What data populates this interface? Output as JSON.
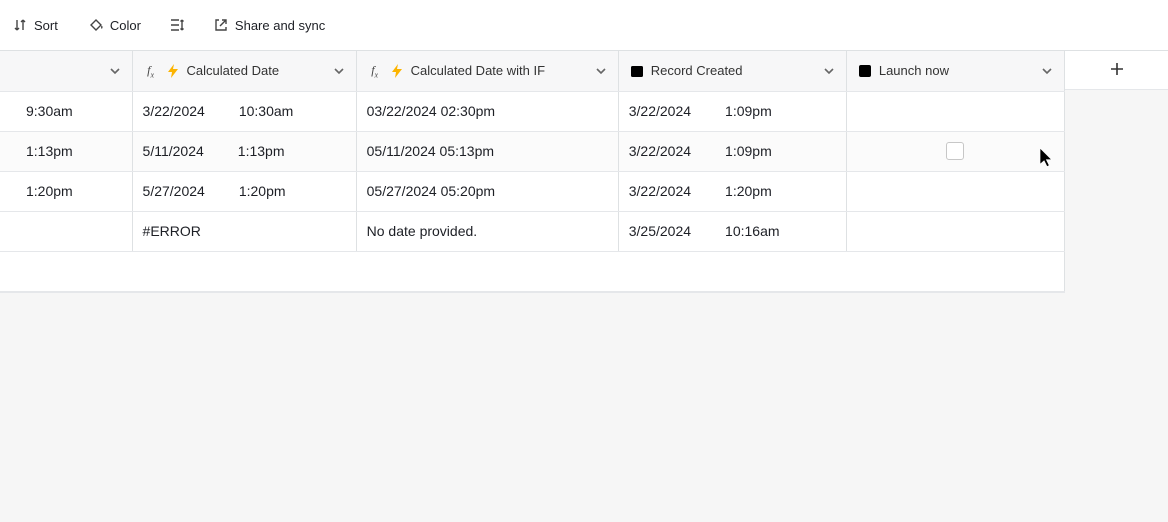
{
  "toolbar": {
    "sort": "Sort",
    "color": "Color",
    "share": "Share and sync"
  },
  "columns": {
    "a": {
      "label": ""
    },
    "b": {
      "label": "Calculated Date"
    },
    "c": {
      "label": "Calculated Date with IF"
    },
    "d": {
      "label": "Record Created"
    },
    "e": {
      "label": "Launch now"
    }
  },
  "rows": [
    {
      "a_time": "9:30am",
      "b_date": "3/22/2024",
      "b_time": "10:30am",
      "c": "03/22/2024 02:30pm",
      "d_date": "3/22/2024",
      "d_time": "1:09pm",
      "e_checked": ""
    },
    {
      "a_time": "1:13pm",
      "b_date": "5/11/2024",
      "b_time": "1:13pm",
      "c": "05/11/2024 05:13pm",
      "d_date": "3/22/2024",
      "d_time": "1:09pm",
      "e_checked": "show"
    },
    {
      "a_time": "1:20pm",
      "b_date": "5/27/2024",
      "b_time": "1:20pm",
      "c": "05/27/2024 05:20pm",
      "d_date": "3/22/2024",
      "d_time": "1:20pm",
      "e_checked": ""
    },
    {
      "a_time": "",
      "b_date": "#ERROR",
      "b_time": "",
      "c": "No date provided.",
      "d_date": "3/25/2024",
      "d_time": "10:16am",
      "e_checked": ""
    }
  ]
}
